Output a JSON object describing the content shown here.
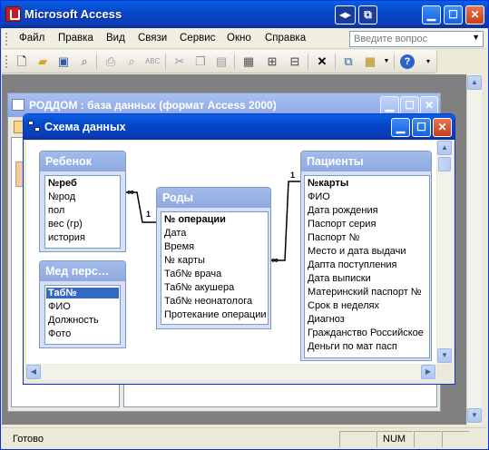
{
  "app": {
    "title": "Microsoft Access"
  },
  "menu": {
    "items": [
      "Файл",
      "Правка",
      "Вид",
      "Связи",
      "Сервис",
      "Окно",
      "Справка"
    ],
    "help_placeholder": "Введите вопрос"
  },
  "db_window": {
    "title": "РОДДОМ : база данных (формат Access 2000)"
  },
  "relationships_window": {
    "title": "Схема данных"
  },
  "tables": {
    "child": {
      "name": "Ребенок",
      "fields": [
        "№реб",
        "№род",
        "пол",
        "вес (гр)",
        "история"
      ]
    },
    "staff": {
      "name": "Мед перс…",
      "fields": [
        "Таб№",
        "ФИО",
        "Должность",
        "Фото"
      ]
    },
    "births": {
      "name": "Роды",
      "fields": [
        "№ операции",
        "Дата",
        "Время",
        "№ карты",
        "Таб№ врача",
        "Таб№ акушера",
        "Таб№ неонатолога",
        "Протекание операции"
      ]
    },
    "patients": {
      "name": "Пациенты",
      "fields": [
        "№карты",
        "ФИО",
        "Дата рождения",
        "Паспорт серия",
        "Паспорт №",
        "Место и дата выдачи",
        "Дапта поступления",
        "Дата выписки",
        "Материнский паспорт №",
        "Срок в неделях",
        "Диагноз",
        "Гражданство Российское",
        "Деньги по мат пасп"
      ]
    }
  },
  "relations": {
    "one": "1",
    "many": "∞"
  },
  "status": {
    "text": "Готово",
    "num": "NUM"
  }
}
